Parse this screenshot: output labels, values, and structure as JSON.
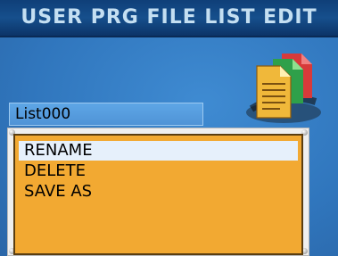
{
  "header": {
    "title": "USER PRG FILE LIST EDIT"
  },
  "file_name_field": {
    "value": "List000"
  },
  "menu": {
    "items": [
      {
        "label": "RENAME",
        "selected": true
      },
      {
        "label": "DELETE",
        "selected": false
      },
      {
        "label": "SAVE AS",
        "selected": false
      }
    ]
  },
  "icons": {
    "file_icon": "documents-icon"
  },
  "colors": {
    "panel": "#f2a932",
    "selection": "#e6f0fb",
    "title_bar": "#164f8c",
    "background": "#3781c8"
  }
}
